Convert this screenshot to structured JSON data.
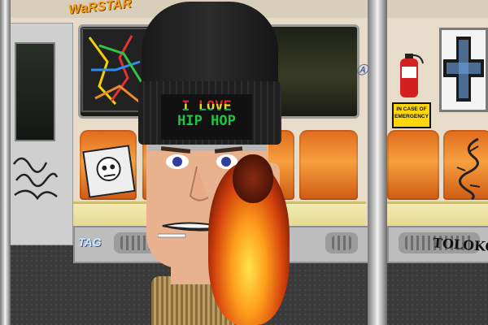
{
  "hat": {
    "line1": "I LOVE",
    "line2": "HIP HOP"
  },
  "emergency_sign": {
    "line1": "IN CASE OF",
    "line2": "EMERGENCY"
  },
  "graffiti": {
    "top": "WaRSTAR",
    "bottom_right": "TOLOKO"
  },
  "colors": {
    "seat": "#f08a2a",
    "wall": "#e7dcc9",
    "hat": "#1f1f1f",
    "flame": "#ff8a1c"
  }
}
